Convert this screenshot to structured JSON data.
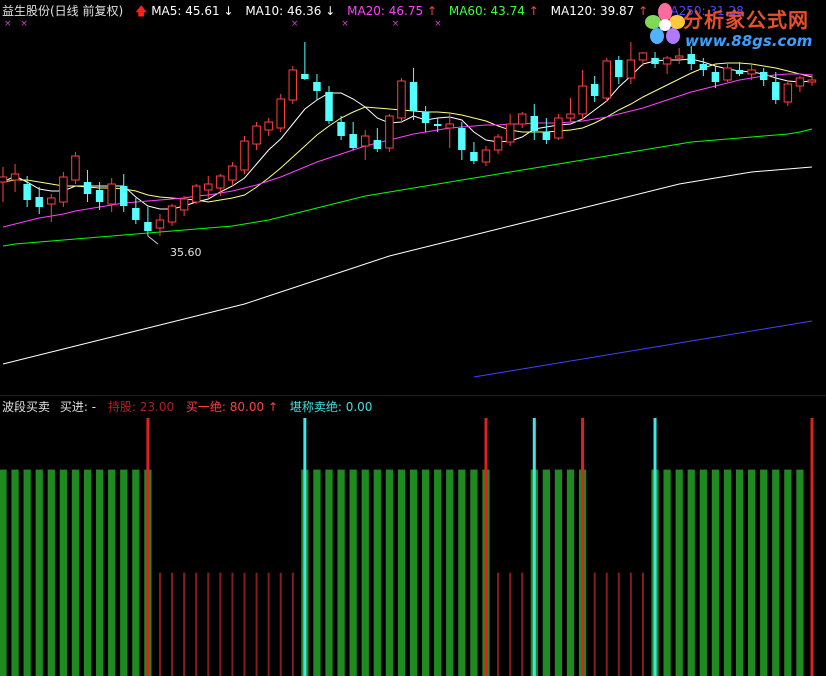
{
  "main_header": {
    "stock": "益生股份(日线 前复权)",
    "ma5": "MA5: 45.61",
    "ma10": "MA10: 46.36",
    "ma20": "MA20: 46.75",
    "ma60": "MA60: 43.74",
    "ma120": "MA120: 39.87",
    "ma250": "MA250: 31.28"
  },
  "low_marker": "35.60",
  "indicator_header": {
    "name": "波段买卖",
    "buy": "买进: -",
    "hold": "持股: 23.00",
    "buy_all": "买一绝: 80.00",
    "sell_all": "堪称卖绝: 0.00"
  },
  "watermark": {
    "title": "分析家公式网",
    "url": "www.88gs.com"
  },
  "colors": {
    "background": "#000000",
    "up": "#ff4040",
    "down": "#54ffff",
    "ma5": "#ffffff",
    "ma10": "#ffff80",
    "ma20": "#ff40ff",
    "ma60": "#00ff00",
    "ma120": "#ffffff",
    "ma250": "#4040ff",
    "hold_bar": "#1f8a1f",
    "empty_bar": "#8b1a1a",
    "buy_signal": "#3ee6e6",
    "sell_signal": "#e02020"
  },
  "chart_data": {
    "type": "candlestick",
    "x": [
      1,
      2,
      3,
      4,
      5,
      6,
      7,
      8,
      9,
      10,
      11,
      12,
      13,
      14,
      15,
      16,
      17,
      18,
      19,
      20,
      21,
      22,
      23,
      24,
      25,
      26,
      27,
      28,
      29,
      30,
      31,
      32,
      33,
      34,
      35,
      36,
      37,
      38,
      39,
      40,
      41,
      42,
      43,
      44,
      45,
      46,
      47,
      48,
      49,
      50,
      51,
      52,
      53,
      54,
      55,
      56,
      57,
      58,
      59,
      60,
      61,
      62,
      63,
      64,
      65,
      66,
      67,
      68
    ],
    "ohlc": [
      [
        41.0,
        42.5,
        39.0,
        41.5
      ],
      [
        41.2,
        42.8,
        40.0,
        41.8
      ],
      [
        40.8,
        41.6,
        38.5,
        39.2
      ],
      [
        39.5,
        40.5,
        37.8,
        38.5
      ],
      [
        38.8,
        39.8,
        37.0,
        39.4
      ],
      [
        39.0,
        42.0,
        38.5,
        41.5
      ],
      [
        41.2,
        44.0,
        40.8,
        43.6
      ],
      [
        41.0,
        42.2,
        39.0,
        39.8
      ],
      [
        40.2,
        41.0,
        38.2,
        39.0
      ],
      [
        38.8,
        41.4,
        38.0,
        40.8
      ],
      [
        40.6,
        41.8,
        38.0,
        38.6
      ],
      [
        38.4,
        39.4,
        36.8,
        37.2
      ],
      [
        37.0,
        38.5,
        35.6,
        36.1
      ],
      [
        36.4,
        37.8,
        35.6,
        37.2
      ],
      [
        37.0,
        38.8,
        36.6,
        38.6
      ],
      [
        38.2,
        39.6,
        37.6,
        39.3
      ],
      [
        39.0,
        40.8,
        38.8,
        40.6
      ],
      [
        40.2,
        41.6,
        39.4,
        40.8
      ],
      [
        40.4,
        41.8,
        39.6,
        41.6
      ],
      [
        41.2,
        43.0,
        40.6,
        42.6
      ],
      [
        42.2,
        45.6,
        41.8,
        45.1
      ],
      [
        44.8,
        47.0,
        44.2,
        46.6
      ],
      [
        46.2,
        47.4,
        45.6,
        47.0
      ],
      [
        46.4,
        49.8,
        46.0,
        49.3
      ],
      [
        49.2,
        52.6,
        48.8,
        52.2
      ],
      [
        51.8,
        55.0,
        51.2,
        51.3
      ],
      [
        51.0,
        51.8,
        49.2,
        50.1
      ],
      [
        50.0,
        50.6,
        46.8,
        47.1
      ],
      [
        47.0,
        47.6,
        45.2,
        45.6
      ],
      [
        45.8,
        47.0,
        44.2,
        44.4
      ],
      [
        44.6,
        46.2,
        43.2,
        45.6
      ],
      [
        45.2,
        46.4,
        44.0,
        44.3
      ],
      [
        44.4,
        47.8,
        44.0,
        47.6
      ],
      [
        47.4,
        51.4,
        47.0,
        51.1
      ],
      [
        51.0,
        52.4,
        47.2,
        48.1
      ],
      [
        48.0,
        48.6,
        46.0,
        46.9
      ],
      [
        46.8,
        47.4,
        46.0,
        46.6
      ],
      [
        46.4,
        47.8,
        44.4,
        46.8
      ],
      [
        46.4,
        47.0,
        43.2,
        44.2
      ],
      [
        44.0,
        45.0,
        42.8,
        43.1
      ],
      [
        43.0,
        44.6,
        42.6,
        44.2
      ],
      [
        44.2,
        45.8,
        43.8,
        45.5
      ],
      [
        45.0,
        47.8,
        44.6,
        46.8
      ],
      [
        46.8,
        48.0,
        46.4,
        47.8
      ],
      [
        47.6,
        48.8,
        45.2,
        46.1
      ],
      [
        46.0,
        47.4,
        44.8,
        45.2
      ],
      [
        45.4,
        47.8,
        45.2,
        47.4
      ],
      [
        47.4,
        49.4,
        47.0,
        47.8
      ],
      [
        47.8,
        52.2,
        47.2,
        50.6
      ],
      [
        50.8,
        51.6,
        49.0,
        49.6
      ],
      [
        49.4,
        53.4,
        49.0,
        53.1
      ],
      [
        53.2,
        53.6,
        50.8,
        51.5
      ],
      [
        51.4,
        55.0,
        50.8,
        53.2
      ],
      [
        53.2,
        54.0,
        52.6,
        53.9
      ],
      [
        53.4,
        54.0,
        52.4,
        52.8
      ],
      [
        52.8,
        53.6,
        51.8,
        53.4
      ],
      [
        53.4,
        54.4,
        52.8,
        53.6
      ],
      [
        53.8,
        54.6,
        52.2,
        52.8
      ],
      [
        52.8,
        53.4,
        51.6,
        52.2
      ],
      [
        52.0,
        52.6,
        50.4,
        51.0
      ],
      [
        51.2,
        52.8,
        51.0,
        52.4
      ],
      [
        52.2,
        53.0,
        51.6,
        51.8
      ],
      [
        51.8,
        52.8,
        51.2,
        52.2
      ],
      [
        52.0,
        52.4,
        50.6,
        51.2
      ],
      [
        51.0,
        52.0,
        48.8,
        49.2
      ],
      [
        49.0,
        51.2,
        48.6,
        50.8
      ],
      [
        50.6,
        51.6,
        50.0,
        51.4
      ],
      [
        51.0,
        51.8,
        50.6,
        51.2
      ]
    ],
    "series": [
      {
        "name": "MA5",
        "values": [
          41.0,
          41.6,
          41.0,
          40.3,
          40.1,
          40.1,
          40.6,
          40.6,
          40.6,
          40.6,
          40.6,
          39.5,
          38.6,
          38.3,
          38.3,
          38.6,
          39.0,
          39.3,
          40.0,
          40.6,
          41.4,
          42.8,
          44.2,
          45.3,
          46.8,
          48.3,
          49.2,
          49.9,
          49.9,
          49.3,
          48.5,
          47.4,
          46.9,
          47.0,
          47.6,
          47.2,
          47.4,
          47.5,
          47.2,
          46.0,
          45.2,
          45.0,
          45.1,
          45.5,
          46.3,
          46.5,
          46.7,
          46.8,
          47.3,
          48.2,
          49.1,
          50.5,
          51.6,
          52.8,
          53.1,
          53.2,
          53.2,
          53.3,
          53.0,
          52.6,
          52.3,
          52.1,
          52.0,
          51.8,
          51.4,
          51.1,
          51.0,
          51.1
        ]
      },
      {
        "name": "MA10",
        "values": [
          41.0,
          41.2,
          41.2,
          41.0,
          40.8,
          40.6,
          40.6,
          40.5,
          40.4,
          40.4,
          40.3,
          40.1,
          39.7,
          39.5,
          39.4,
          39.3,
          39.2,
          39.0,
          39.2,
          39.4,
          39.7,
          40.5,
          41.4,
          42.4,
          43.5,
          44.6,
          45.7,
          46.6,
          47.4,
          48.0,
          48.5,
          48.4,
          48.3,
          48.2,
          48.1,
          48.0,
          48.0,
          47.9,
          47.7,
          47.4,
          47.1,
          46.6,
          46.2,
          46.0,
          46.0,
          46.0,
          46.1,
          46.2,
          46.4,
          46.9,
          47.5,
          48.2,
          48.8,
          49.5,
          50.1,
          50.7,
          51.3,
          51.9,
          52.4,
          52.8,
          52.9,
          52.9,
          52.8,
          52.6,
          52.4,
          52.1,
          51.8,
          51.5
        ]
      },
      {
        "name": "MA20",
        "values": [
          36.5,
          36.8,
          37.1,
          37.4,
          37.6,
          37.8,
          38.1,
          38.3,
          38.5,
          38.7,
          38.9,
          39.0,
          39.1,
          39.2,
          39.3,
          39.4,
          39.6,
          39.7,
          39.9,
          40.1,
          40.4,
          40.7,
          41.1,
          41.5,
          42.0,
          42.5,
          43.0,
          43.4,
          43.8,
          44.2,
          44.6,
          44.9,
          45.2,
          45.5,
          45.8,
          46.0,
          46.2,
          46.4,
          46.5,
          46.6,
          46.7,
          46.7,
          46.8,
          46.8,
          46.9,
          46.9,
          46.9,
          47.0,
          47.1,
          47.3,
          47.5,
          47.8,
          48.1,
          48.4,
          48.8,
          49.2,
          49.6,
          50.0,
          50.3,
          50.6,
          50.9,
          51.2,
          51.4,
          51.6,
          51.7,
          51.8,
          51.8,
          51.7
        ]
      },
      {
        "name": "MA60",
        "values": [
          34.6,
          34.8,
          34.9,
          35.0,
          35.1,
          35.2,
          35.3,
          35.4,
          35.5,
          35.6,
          35.7,
          35.8,
          35.9,
          36.0,
          36.1,
          36.2,
          36.3,
          36.4,
          36.5,
          36.6,
          36.8,
          37.0,
          37.2,
          37.5,
          37.8,
          38.1,
          38.4,
          38.7,
          39.0,
          39.3,
          39.6,
          39.8,
          40.0,
          40.2,
          40.4,
          40.6,
          40.8,
          41.0,
          41.2,
          41.4,
          41.6,
          41.8,
          42.0,
          42.2,
          42.4,
          42.6,
          42.8,
          43.0,
          43.2,
          43.4,
          43.6,
          43.8,
          44.0,
          44.2,
          44.4,
          44.6,
          44.8,
          45.0,
          45.1,
          45.2,
          45.3,
          45.4,
          45.5,
          45.6,
          45.7,
          45.8,
          46.0,
          46.3
        ]
      },
      {
        "name": "MA120",
        "values": [
          22.8,
          23.1,
          23.4,
          23.7,
          24.0,
          24.3,
          24.6,
          24.9,
          25.2,
          25.5,
          25.8,
          26.1,
          26.4,
          26.7,
          27.0,
          27.3,
          27.6,
          27.9,
          28.2,
          28.5,
          28.8,
          29.2,
          29.6,
          30.0,
          30.4,
          30.8,
          31.2,
          31.6,
          32.0,
          32.4,
          32.8,
          33.2,
          33.6,
          33.9,
          34.2,
          34.5,
          34.8,
          35.1,
          35.4,
          35.7,
          36.0,
          36.3,
          36.6,
          36.9,
          37.2,
          37.5,
          37.8,
          38.1,
          38.4,
          38.7,
          39.0,
          39.3,
          39.6,
          39.9,
          40.2,
          40.5,
          40.8,
          41.0,
          41.2,
          41.4,
          41.6,
          41.8,
          42.0,
          42.1,
          42.2,
          42.3,
          42.4,
          42.5
        ]
      },
      {
        "name": "MA250",
        "x_start": 40,
        "values": [
          21.5,
          21.7,
          21.9,
          22.1,
          22.3,
          22.5,
          22.7,
          22.9,
          23.1,
          23.3,
          23.5,
          23.7,
          23.9,
          24.1,
          24.3,
          24.5,
          24.7,
          24.9,
          25.1,
          25.3,
          25.5,
          25.7,
          25.9,
          26.1,
          26.3,
          26.5,
          26.7,
          26.9,
          27.1
        ]
      }
    ],
    "price_range": [
      20.0,
      57.0
    ],
    "indicator": {
      "hold_value": 80,
      "empty_value": 40,
      "signal_value": 100,
      "state": [
        "h",
        "h",
        "h",
        "h",
        "h",
        "h",
        "h",
        "h",
        "h",
        "h",
        "h",
        "h",
        "h",
        "e",
        "e",
        "e",
        "e",
        "e",
        "e",
        "e",
        "e",
        "e",
        "e",
        "e",
        "e",
        "h",
        "h",
        "h",
        "h",
        "h",
        "h",
        "h",
        "h",
        "h",
        "h",
        "h",
        "h",
        "h",
        "h",
        "h",
        "h",
        "e",
        "e",
        "e",
        "h",
        "h",
        "h",
        "h",
        "h",
        "e",
        "e",
        "e",
        "e",
        "e",
        "h",
        "h",
        "h",
        "h",
        "h",
        "h",
        "h",
        "h",
        "h",
        "h",
        "h",
        "h",
        "h",
        "e"
      ],
      "buy_signals": [
        26,
        45,
        55
      ],
      "sell_signals": [
        13,
        41,
        49,
        68
      ],
      "range": [
        0,
        100
      ]
    }
  }
}
